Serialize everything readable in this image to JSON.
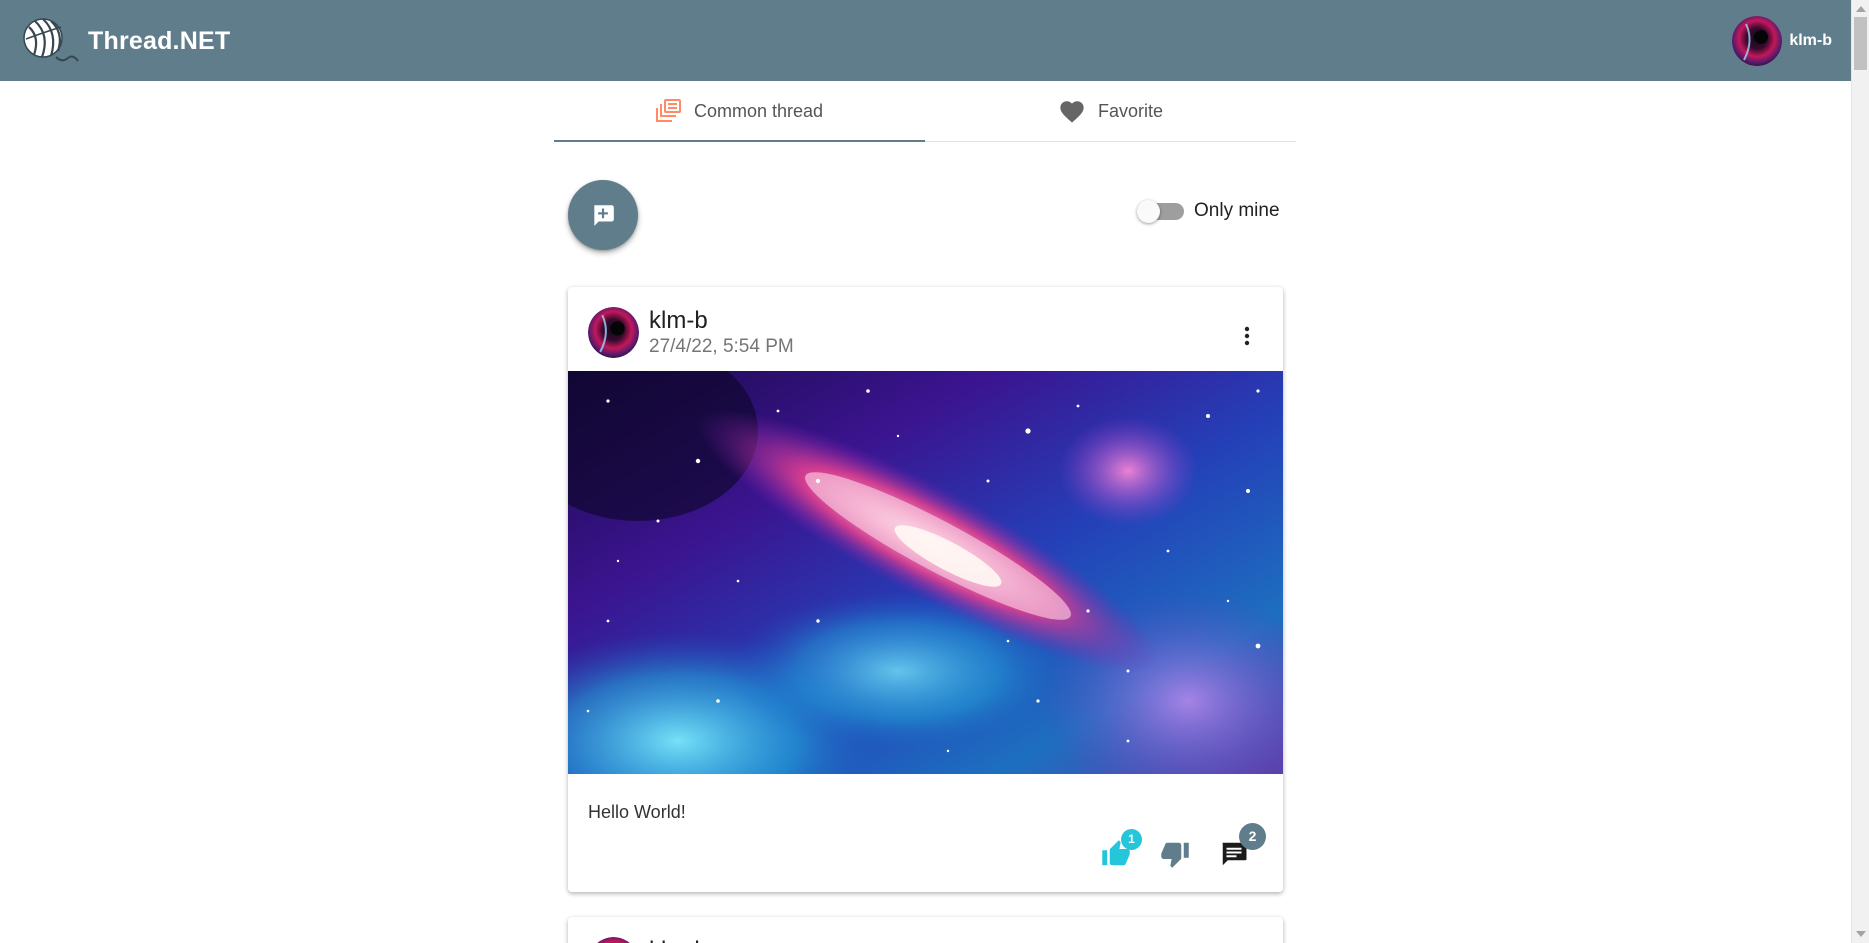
{
  "app": {
    "title": "Thread.NET",
    "user": {
      "name": "klm-b"
    }
  },
  "tabs": [
    {
      "label": "Common thread",
      "active": true,
      "icon": "stacked-posts-icon"
    },
    {
      "label": "Favorite",
      "active": false,
      "icon": "heart-icon"
    }
  ],
  "toolbar": {
    "create_post_icon": "add-comment-icon",
    "only_mine_label": "Only mine",
    "only_mine_on": false
  },
  "posts": [
    {
      "author": "klm-b",
      "date": "27/4/22, 5:54 PM",
      "body": "Hello World!",
      "has_image": true,
      "likes": "1",
      "comments": "2"
    },
    {
      "author": "klm-b"
    }
  ],
  "colors": {
    "primary": "#607d8b",
    "accent_like": "#26c6da",
    "tab_icon_active": "#ff8a65"
  }
}
